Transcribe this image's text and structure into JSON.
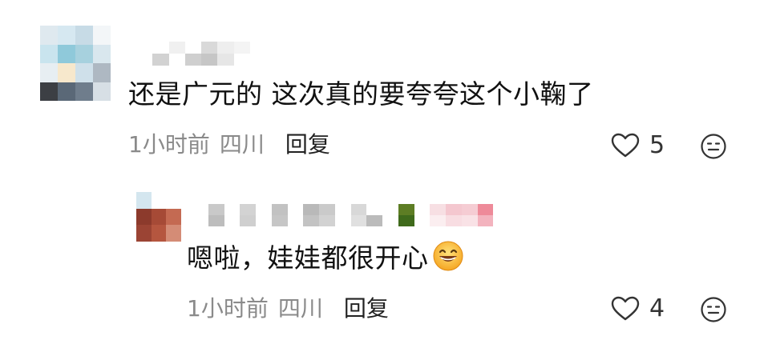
{
  "comment": {
    "text": "还是广元的 这次真的要夸夸这个小鞠了",
    "time": "1小时前",
    "location": "四川",
    "reply_label": "回复",
    "likes": "5"
  },
  "reply": {
    "text": "嗯啦，娃娃都很开心",
    "emoji": "grinning-face-emoji",
    "time": "1小时前",
    "location": "四川",
    "reply_label": "回复",
    "likes": "4"
  },
  "icons": {
    "like": "heart-outline-icon",
    "react": "neutral-face-icon"
  },
  "colors": {
    "text": "#111111",
    "meta": "#8a8a8a",
    "icon": "#333333"
  }
}
